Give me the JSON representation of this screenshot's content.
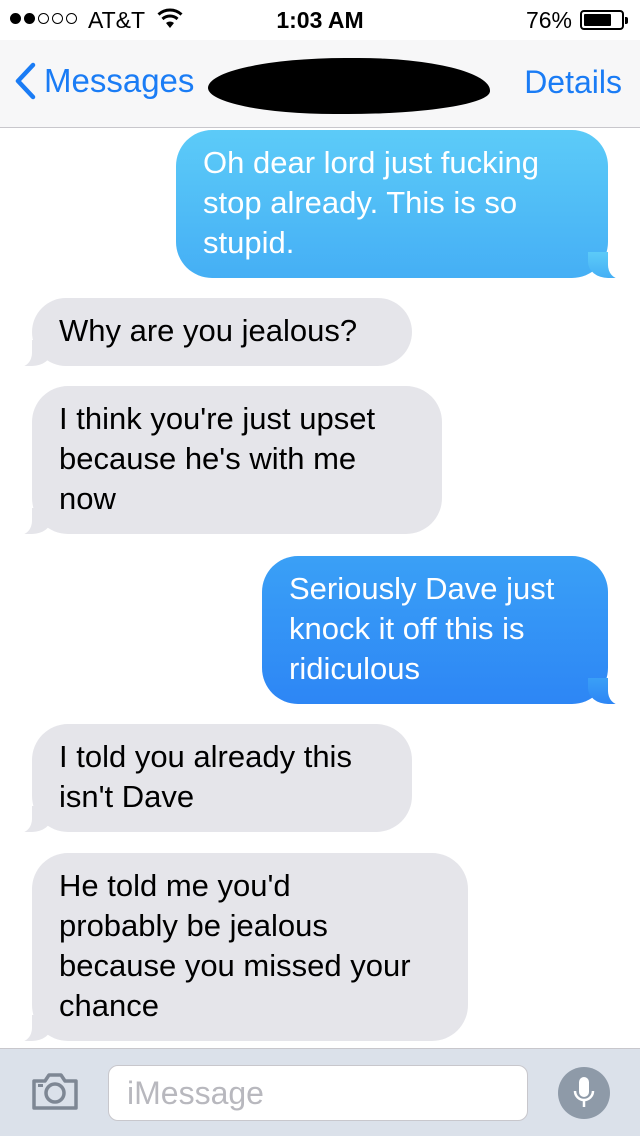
{
  "status_bar": {
    "carrier": "AT&T",
    "signal_bars_filled": 2,
    "signal_bars_total": 5,
    "time": "1:03 AM",
    "battery_percent": "76%",
    "battery_level": 0.76,
    "wifi_icon": "wifi-icon"
  },
  "nav": {
    "back_label": "Messages",
    "back_icon": "chevron-left-icon",
    "details_label": "Details"
  },
  "messages": [
    {
      "direction": "outgoing",
      "lines": [
        "Oh dear lord just fucking",
        "stop already. This is so",
        "stupid."
      ]
    },
    {
      "direction": "incoming",
      "lines": [
        "Why are you jealous?"
      ]
    },
    {
      "direction": "incoming",
      "lines": [
        "I think you're just upset",
        "because he's with me",
        "now"
      ]
    },
    {
      "direction": "outgoing",
      "lines": [
        "Seriously Dave just",
        "knock it off this is",
        "ridiculous"
      ]
    },
    {
      "direction": "incoming",
      "lines": [
        "I told you already this",
        "isn't Dave"
      ]
    },
    {
      "direction": "incoming",
      "lines": [
        "He told me you'd",
        "probably be jealous",
        "because you missed your",
        "chance"
      ]
    }
  ],
  "input_bar": {
    "placeholder": "iMessage",
    "camera_icon": "camera-icon",
    "mic_icon": "microphone-icon"
  },
  "colors": {
    "accent": "#1a7cf5",
    "incoming_bubble": "#e5e5ea",
    "outgoing_bubble_light": "#5ccbf8",
    "outgoing_bubble_dark": "#2d86f5"
  }
}
